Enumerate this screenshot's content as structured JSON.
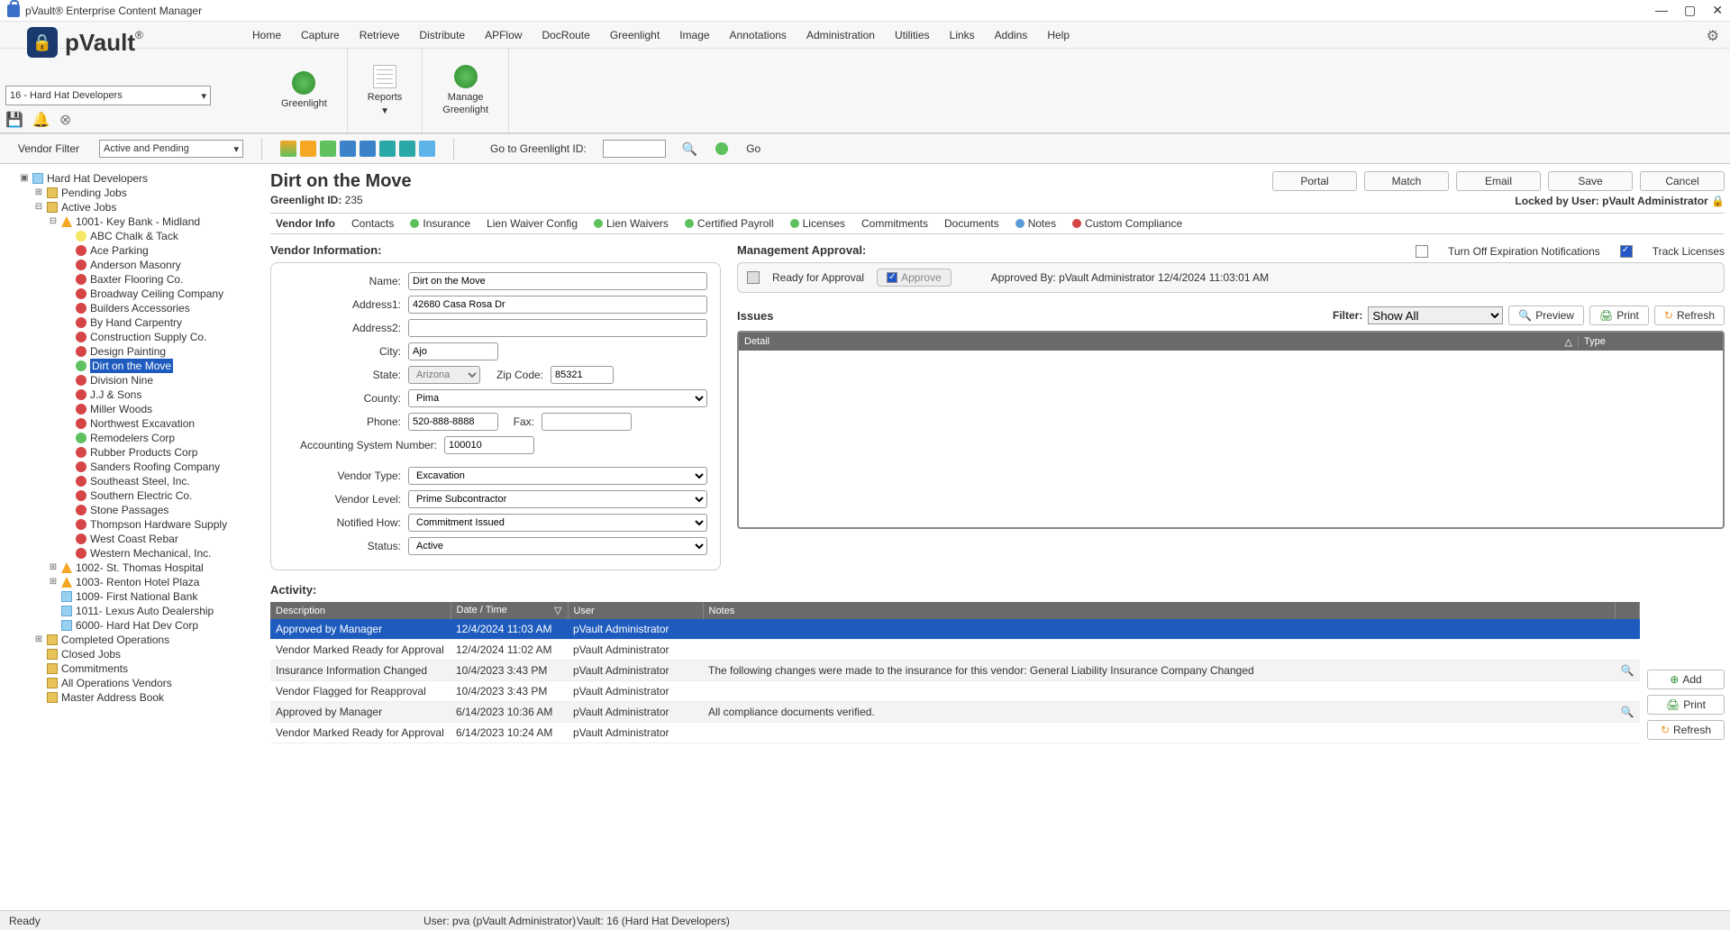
{
  "window": {
    "title": "pVault® Enterprise Content Manager"
  },
  "logo": {
    "text": "pVault",
    "reg": "®"
  },
  "menu": [
    "Home",
    "Capture",
    "Retrieve",
    "Distribute",
    "APFlow",
    "DocRoute",
    "Greenlight",
    "Image",
    "Annotations",
    "Administration",
    "Utilities",
    "Links",
    "Addins",
    "Help"
  ],
  "company_selector": "16 - Hard Hat Developers",
  "ribbon": {
    "greenlight": "Greenlight",
    "reports": "Reports",
    "manage": "Manage\nGreenlight"
  },
  "toolbar": {
    "vendor_filter_label": "Vendor Filter",
    "vendor_filter_value": "Active and Pending",
    "go_label": "Go to Greenlight ID:",
    "go_button": "Go"
  },
  "tree": {
    "root": "Hard Hat Developers",
    "pending": "Pending Jobs",
    "active": "Active Jobs",
    "job_1001": "1001- Key Bank - Midland",
    "vendors": [
      {
        "name": "ABC Chalk & Tack",
        "c": "yellow"
      },
      {
        "name": "Ace Parking",
        "c": "red"
      },
      {
        "name": "Anderson Masonry",
        "c": "red"
      },
      {
        "name": "Baxter Flooring Co.",
        "c": "red"
      },
      {
        "name": "Broadway Ceiling Company",
        "c": "red"
      },
      {
        "name": "Builders Accessories",
        "c": "red"
      },
      {
        "name": "By Hand Carpentry",
        "c": "red"
      },
      {
        "name": "Construction Supply Co.",
        "c": "red"
      },
      {
        "name": "Design Painting",
        "c": "red"
      },
      {
        "name": "Dirt on the Move",
        "c": "green",
        "sel": true
      },
      {
        "name": "Division Nine",
        "c": "red"
      },
      {
        "name": "J.J & Sons",
        "c": "red"
      },
      {
        "name": "Miller Woods",
        "c": "red"
      },
      {
        "name": "Northwest Excavation",
        "c": "red"
      },
      {
        "name": "Remodelers Corp",
        "c": "green"
      },
      {
        "name": "Rubber Products Corp",
        "c": "red"
      },
      {
        "name": "Sanders Roofing Company",
        "c": "red"
      },
      {
        "name": "Southeast Steel, Inc.",
        "c": "red"
      },
      {
        "name": "Southern Electric Co.",
        "c": "red"
      },
      {
        "name": "Stone Passages",
        "c": "red"
      },
      {
        "name": "Thompson Hardware Supply",
        "c": "red"
      },
      {
        "name": "West Coast Rebar",
        "c": "red"
      },
      {
        "name": "Western Mechanical, Inc.",
        "c": "red"
      }
    ],
    "jobs_after": [
      "1002- St. Thomas Hospital",
      "1003- Renton Hotel Plaza",
      "1009- First National Bank",
      "1011- Lexus Auto Dealership",
      "6000- Hard Hat Dev Corp"
    ],
    "completed": "Completed Operations",
    "closed": "Closed Jobs",
    "commitments": "Commitments",
    "all_ops": "All Operations Vendors",
    "mab": "Master Address Book"
  },
  "page": {
    "title": "Dirt on the Move",
    "greenlight_id_label": "Greenlight ID: ",
    "greenlight_id": "235",
    "buttons": {
      "portal": "Portal",
      "match": "Match",
      "email": "Email",
      "save": "Save",
      "cancel": "Cancel"
    },
    "locked_by_label": "Locked by User: ",
    "locked_by_user": "pVault Administrator"
  },
  "tabs": [
    "Vendor Info",
    "Contacts",
    "Insurance",
    "Lien Waiver Config",
    "Lien Waivers",
    "Certified Payroll",
    "Licenses",
    "Commitments",
    "Documents",
    "Notes",
    "Custom Compliance"
  ],
  "checks": {
    "turn_off": "Turn Off Expiration Notifications",
    "track": "Track Licenses"
  },
  "vendor_section": {
    "title": "Vendor Information:",
    "name_label": "Name:",
    "name": "Dirt on the Move",
    "addr1_label": "Address1:",
    "addr1": "42680 Casa Rosa Dr",
    "addr2_label": "Address2:",
    "addr2": "",
    "city_label": "City:",
    "city": "Ajo",
    "state_label": "State:",
    "state": "Arizona",
    "zip_label": "Zip Code:",
    "zip": "85321",
    "county_label": "County:",
    "county": "Pima",
    "phone_label": "Phone:",
    "phone": "520-888-8888",
    "fax_label": "Fax:",
    "fax": "",
    "acct_label": "Accounting System Number:",
    "acct": "100010",
    "vtype_label": "Vendor Type:",
    "vtype": "Excavation",
    "vlevel_label": "Vendor Level:",
    "vlevel": "Prime Subcontractor",
    "notified_label": "Notified How:",
    "notified": "Commitment Issued",
    "status_label": "Status:",
    "status": "Active"
  },
  "approval": {
    "title": "Management Approval:",
    "ready": "Ready for Approval",
    "approve": "Approve",
    "approved_by": "Approved By: pVault Administrator 12/4/2024 11:03:01 AM"
  },
  "issues": {
    "title": "Issues",
    "filter_label": "Filter:",
    "filter_value": "Show All",
    "preview": "Preview",
    "print": "Print",
    "refresh": "Refresh",
    "col_detail": "Detail",
    "col_type": "Type"
  },
  "activity": {
    "title": "Activity:",
    "cols": {
      "desc": "Description",
      "date": "Date / Time",
      "user": "User",
      "notes": "Notes"
    },
    "rows": [
      {
        "desc": "Approved by Manager",
        "date": "12/4/2024 11:03 AM",
        "user": "pVault Administrator",
        "notes": "",
        "mag": false
      },
      {
        "desc": "Vendor Marked Ready for Approval",
        "date": "12/4/2024 11:02 AM",
        "user": "pVault Administrator",
        "notes": "",
        "mag": false
      },
      {
        "desc": "Insurance Information Changed",
        "date": "10/4/2023 3:43 PM",
        "user": "pVault Administrator",
        "notes": "The following changes were made to the insurance for this vendor: General Liability Insurance Company Changed",
        "mag": true
      },
      {
        "desc": "Vendor Flagged for Reapproval",
        "date": "10/4/2023 3:43 PM",
        "user": "pVault Administrator",
        "notes": "",
        "mag": false
      },
      {
        "desc": "Approved by Manager",
        "date": "6/14/2023 10:36 AM",
        "user": "pVault Administrator",
        "notes": "All compliance documents verified.",
        "mag": true
      },
      {
        "desc": "Vendor Marked Ready for Approval",
        "date": "6/14/2023 10:24 AM",
        "user": "pVault Administrator",
        "notes": "",
        "mag": false
      }
    ],
    "add": "Add",
    "print": "Print",
    "refresh": "Refresh"
  },
  "status": {
    "ready": "Ready",
    "user": "User: pva (pVault Administrator)",
    "vault": "Vault: 16 (Hard Hat Developers)"
  }
}
